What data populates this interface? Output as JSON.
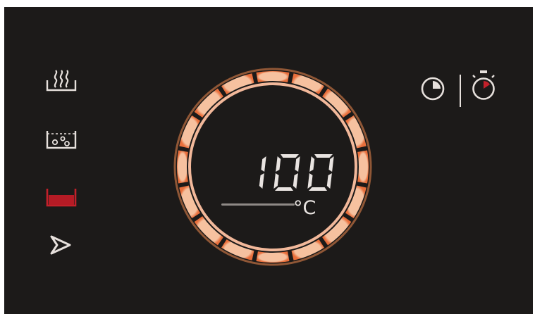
{
  "display": {
    "temperature_value": "100",
    "temperature_unit": "°C",
    "ring_segments_lit": 16,
    "ring_segments_total": 16
  },
  "modes": [
    {
      "icon": "steam-icon",
      "active": false
    },
    {
      "icon": "bubbles-icon",
      "active": false
    },
    {
      "icon": "bottom-heat-icon",
      "active": true
    },
    {
      "icon": "start-play-icon",
      "active": false
    }
  ],
  "timer": {
    "icons": [
      "clock-timer-icon",
      "stopwatch-icon"
    ]
  },
  "colors": {
    "background": "#1c1a19",
    "segment_orange": "#f08a4e",
    "ring_light": "#f2b89a",
    "active_red": "#c2202a",
    "icon_light": "#e6e0dc"
  }
}
